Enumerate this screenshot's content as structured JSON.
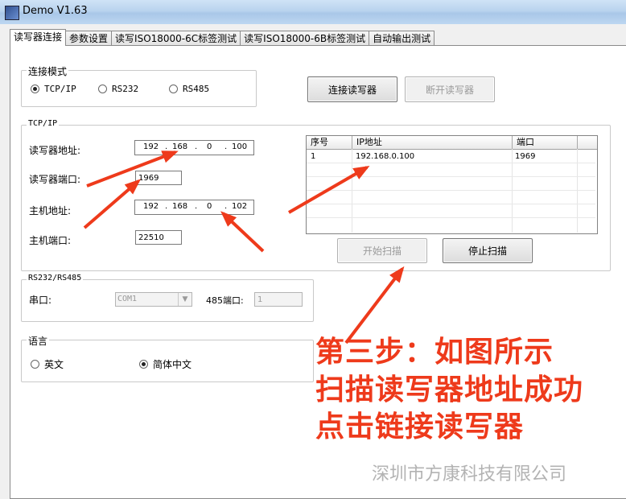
{
  "window": {
    "title": "Demo  V1.63",
    "icon": "app-icon"
  },
  "tabs": [
    {
      "label": "读写器连接"
    },
    {
      "label": "参数设置"
    },
    {
      "label": "读写ISO18000-6C标签测试"
    },
    {
      "label": "读写ISO18000-6B标签测试"
    },
    {
      "label": "自动输出测试"
    }
  ],
  "connect_mode": {
    "legend": "连接模式",
    "options": [
      "TCP/IP",
      "RS232",
      "RS485"
    ],
    "selected": "TCP/IP"
  },
  "buttons": {
    "connect": "连接读写器",
    "disconnect": "断开读写器",
    "start_scan": "开始扫描",
    "stop_scan": "停止扫描"
  },
  "tcpip": {
    "legend": "TCP/IP",
    "reader_addr_label": "读写器地址:",
    "reader_addr": [
      "192",
      "168",
      "0",
      "100"
    ],
    "reader_port_label": "读写器端口:",
    "reader_port": "1969",
    "host_addr_label": "主机地址:",
    "host_addr": [
      "192",
      "168",
      "0",
      "102"
    ],
    "host_port_label": "主机端口:",
    "host_port": "22510",
    "dot": "."
  },
  "scan_table": {
    "columns": [
      "序号",
      "IP地址",
      "端口"
    ],
    "rows": [
      {
        "index": "1",
        "ip": "192.168.0.100",
        "port": "1969"
      }
    ]
  },
  "serial": {
    "legend": "RS232/RS485",
    "port_label": "串口:",
    "port_value": "COM1",
    "rs485_label": "485端口:",
    "rs485_value": "1"
  },
  "language": {
    "legend": "语言",
    "options": [
      "英文",
      "简体中文"
    ],
    "selected": "简体中文"
  },
  "annotation": {
    "lines": [
      "第三步：如图所示",
      "扫描读写器地址成功",
      "点击链接读写器"
    ],
    "color": "#ee3a1b"
  },
  "watermark": "深圳市方康科技有限公司"
}
